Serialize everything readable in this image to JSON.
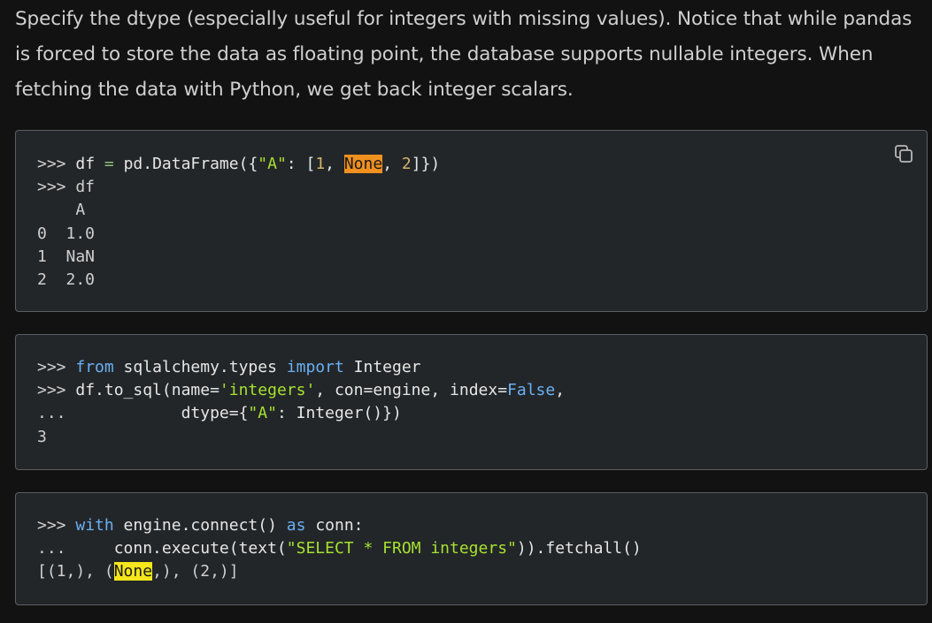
{
  "intro": {
    "text": "Specify the dtype (especially useful for integers with missing values). Notice that while pandas is forced to store the data as floating point, the database supports nullable integers. When fetching the data with Python, we get back integer scalars."
  },
  "copy_button": {
    "icon": "copy-icon"
  },
  "block1": {
    "line1": {
      "prompt": ">>> ",
      "var": "df",
      "eq": " = ",
      "call": "pd.DataFrame({",
      "key": "\"A\"",
      "colon": ": [",
      "n1": "1",
      "comma1": ", ",
      "none": "None",
      "comma2": ", ",
      "n2": "2",
      "close": "]})"
    },
    "line2": ">>> df",
    "output": [
      "    A",
      "0  1.0",
      "1  NaN",
      "2  2.0"
    ]
  },
  "block2": {
    "line1": {
      "prompt": ">>> ",
      "kw_from": "from",
      "module": " sqlalchemy.types ",
      "kw_import": "import",
      "name": " Integer"
    },
    "line2": {
      "prompt": ">>> ",
      "call": "df.to_sql(name=",
      "str": "'integers'",
      "rest1": ", con=engine, index=",
      "false": "False",
      "rest2": ","
    },
    "line3": {
      "prompt": "...            ",
      "dtype": "dtype={",
      "key": "\"A\"",
      "rest": ": Integer()})"
    },
    "output": "3"
  },
  "block3": {
    "line1": {
      "prompt": ">>> ",
      "kw_with": "with",
      "mid": " engine.connect() ",
      "kw_as": "as",
      "rest": " conn:"
    },
    "line2": {
      "prompt": "...     ",
      "call": "conn.execute(text(",
      "str": "\"SELECT * FROM integers\"",
      "rest": ")).fetchall()"
    },
    "line3": {
      "pre": "[(1,), (",
      "none": "None",
      "post": ",), (2,)]"
    }
  }
}
